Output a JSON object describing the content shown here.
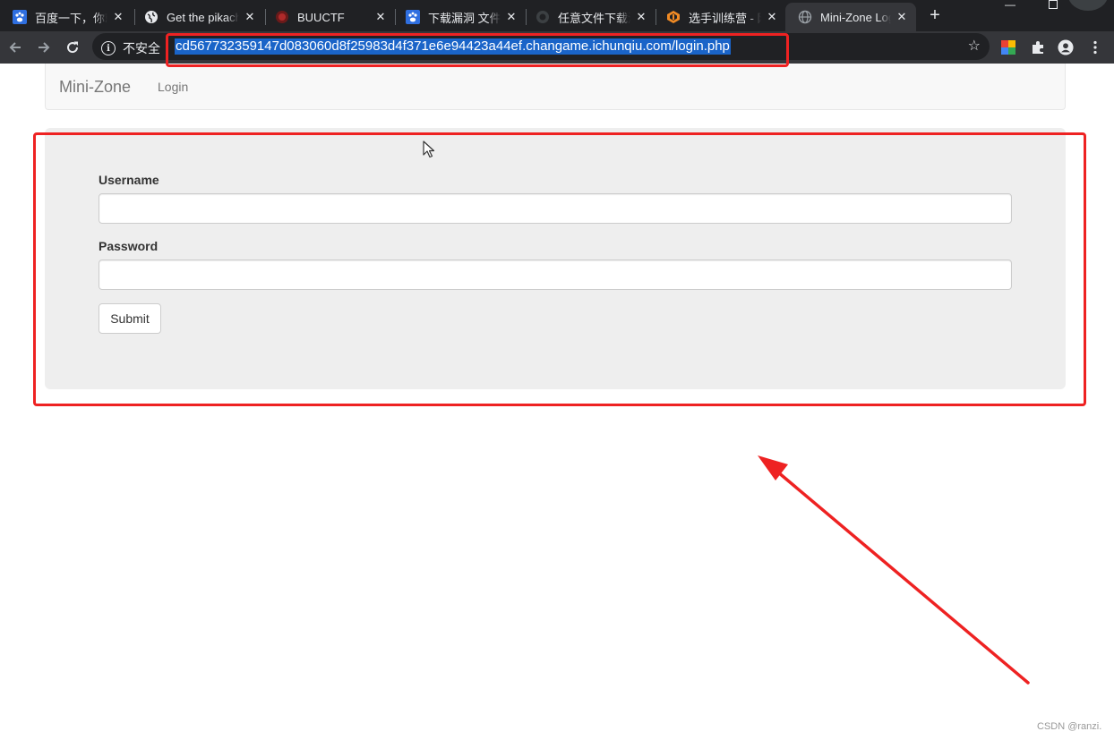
{
  "browser": {
    "tabs": [
      {
        "title": "百度一下，你就",
        "favicon": "baidu-paw-icon",
        "active": false
      },
      {
        "title": "Get the pikach",
        "favicon": "globe-icon",
        "active": false
      },
      {
        "title": "BUUCTF",
        "favicon": "buuctf-icon",
        "active": false
      },
      {
        "title": "下载漏洞 文件_",
        "favicon": "baidu-paw-icon",
        "active": false
      },
      {
        "title": "任意文件下载漏",
        "favicon": "github-icon",
        "active": false
      },
      {
        "title": "选手训练营 - 网",
        "favicon": "ichunqiu-icon",
        "active": false
      },
      {
        "title": "Mini-Zone Login",
        "favicon": "globe-icon",
        "active": true
      }
    ],
    "new_tab_symbol": "+",
    "security_label": "不安全",
    "url": "cd567732359147d083060d8f25983d4f371e6e94423a44ef.changame.ichunqiu.com/login.php"
  },
  "navbar": {
    "brand": "Mini-Zone",
    "link": "Login"
  },
  "form": {
    "username_label": "Username",
    "username_value": "",
    "password_label": "Password",
    "password_value": "",
    "submit_label": "Submit"
  },
  "watermark": "CSDN @ranzi.",
  "colors": {
    "annotation_red": "#ee2222",
    "url_highlight": "#1a64c8",
    "browser_dark": "#202124",
    "toolbar": "#35363a",
    "well_bg": "#eeeeee",
    "navbar_bg": "#f8f8f8"
  }
}
